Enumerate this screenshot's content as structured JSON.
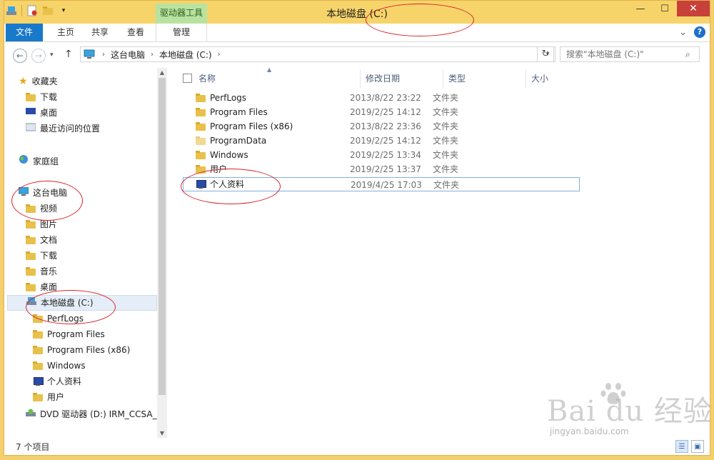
{
  "window": {
    "title": "本地磁盘 (C:)",
    "context_tab": "驱动器工具",
    "controls": {
      "minimize": "—",
      "maximize": "☐",
      "close": "✕"
    }
  },
  "ribbon": {
    "tabs": [
      "文件",
      "主页",
      "共享",
      "查看",
      "管理"
    ],
    "expand_glyph": "⌄",
    "help": "?"
  },
  "address": {
    "back": "←",
    "forward": "→",
    "history": "▾",
    "up": "↑",
    "path": [
      "这台电脑",
      "本地磁盘 (C:)"
    ],
    "refresh": "↻",
    "search_placeholder": "搜索\"本地磁盘 (C:)\""
  },
  "nav": {
    "favorites": "收藏夹",
    "favorites_items": [
      "下载",
      "桌面",
      "最近访问的位置"
    ],
    "homegroup": "家庭组",
    "this_pc": "这台电脑",
    "pc_items": [
      "视频",
      "图片",
      "文档",
      "下载",
      "音乐",
      "桌面"
    ],
    "local_disk": "本地磁盘 (C:)",
    "disk_items": [
      "PerfLogs",
      "Program Files",
      "Program Files (x86)",
      "Windows",
      "个人资料",
      "用户"
    ],
    "dvd": "DVD 驱动器 (D:) IRM_CCSA_X"
  },
  "list": {
    "columns": {
      "name": "名称",
      "date": "修改日期",
      "type": "类型",
      "size": "大小"
    },
    "rows": [
      {
        "name": "PerfLogs",
        "date": "2013/8/22 23:22",
        "type": "文件夹",
        "icon": "folder"
      },
      {
        "name": "Program Files",
        "date": "2019/2/25 14:12",
        "type": "文件夹",
        "icon": "folder"
      },
      {
        "name": "Program Files (x86)",
        "date": "2013/8/22 23:36",
        "type": "文件夹",
        "icon": "folder"
      },
      {
        "name": "ProgramData",
        "date": "2019/2/25 14:12",
        "type": "文件夹",
        "icon": "folder"
      },
      {
        "name": "Windows",
        "date": "2019/2/25 13:34",
        "type": "文件夹",
        "icon": "folder"
      },
      {
        "name": "用户",
        "date": "2019/2/25 13:37",
        "type": "文件夹",
        "icon": "folder"
      },
      {
        "name": "个人资料",
        "date": "2019/4/25 17:03",
        "type": "文件夹",
        "icon": "monitor"
      }
    ]
  },
  "status": {
    "count": "7 个项目"
  },
  "watermark": {
    "text": "Bai du 经验",
    "url": "jingyan.baidu.com"
  },
  "colors": {
    "title_bar": "#f7d469",
    "file_tab": "#1979ca",
    "context_tab": "#b9e2a0",
    "annotation": "#d9242a"
  }
}
